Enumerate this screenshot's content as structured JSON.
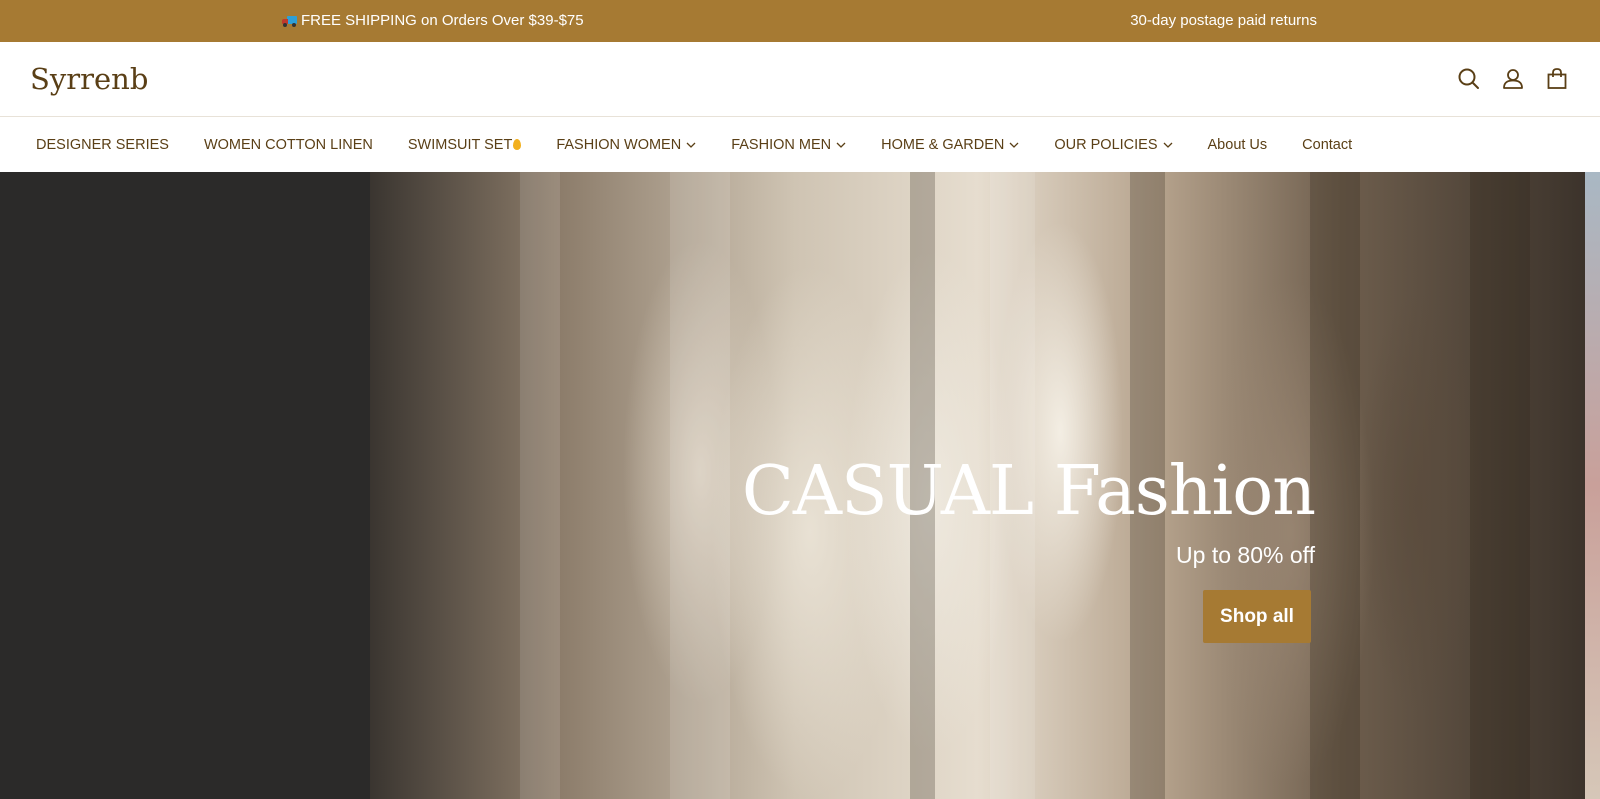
{
  "announcement": {
    "left_text": "FREE SHIPPING on Orders Over $39-$75",
    "left_icon": "truck-icon",
    "right_text": "30-day postage paid returns",
    "background": "#a67a33"
  },
  "header": {
    "logo": "Syrrenb",
    "icons": [
      "search-icon",
      "account-icon",
      "cart-icon"
    ]
  },
  "nav": {
    "items": [
      {
        "label": "DESIGNER SERIES"
      },
      {
        "label": "WOMEN COTTON LINEN"
      },
      {
        "label": "SWIMSUIT SET"
      },
      {
        "label": "FASHION WOMEN"
      },
      {
        "label": "FASHION MEN"
      },
      {
        "label": "HOME & GARDEN"
      },
      {
        "label": "OUR POLICIES"
      },
      {
        "label": "About Us"
      },
      {
        "label": "Contact"
      }
    ]
  },
  "hero": {
    "title": "CASUAL Fashion",
    "subtitle": "Up to 80% off",
    "button_label": "Shop all",
    "accent": "#a67a33"
  }
}
